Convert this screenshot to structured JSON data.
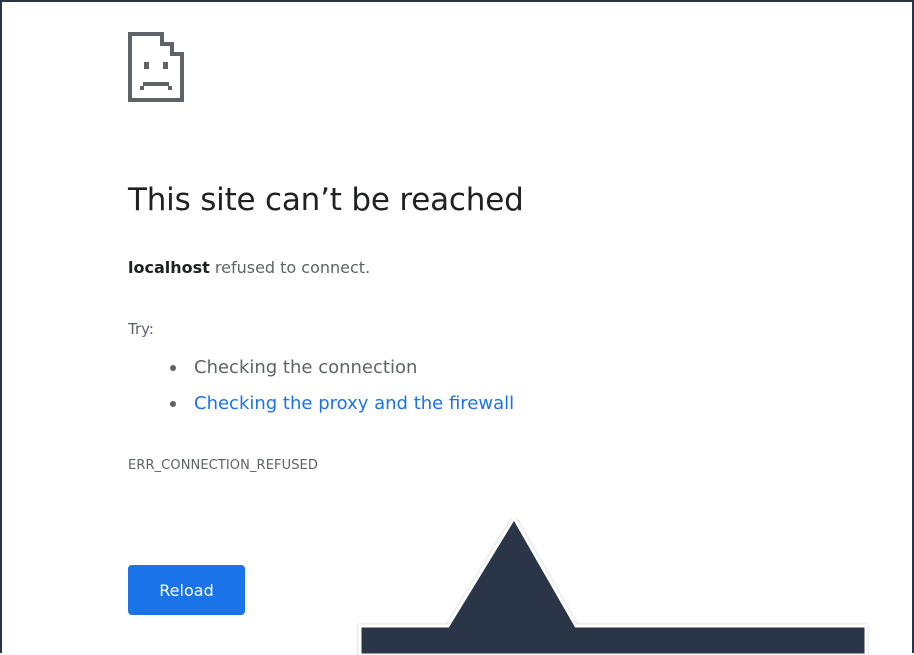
{
  "error": {
    "title": "This site can’t be reached",
    "host": "localhost",
    "message": " refused to connect.",
    "try_label": "Try:",
    "suggestions": [
      {
        "label": "Checking the connection",
        "is_link": false
      },
      {
        "label": "Checking the proxy and the firewall",
        "is_link": true
      }
    ],
    "code": "ERR_CONNECTION_REFUSED"
  },
  "actions": {
    "reload_label": "Reload"
  },
  "colors": {
    "accent": "#1a73e8",
    "text_primary": "#202124",
    "text_secondary": "#5f6368",
    "frame": "#2b3446",
    "overlay": "#2b3446"
  },
  "icons": {
    "error_icon": "sad-page-icon",
    "tooltip": "tooltip-pointer-icon"
  }
}
